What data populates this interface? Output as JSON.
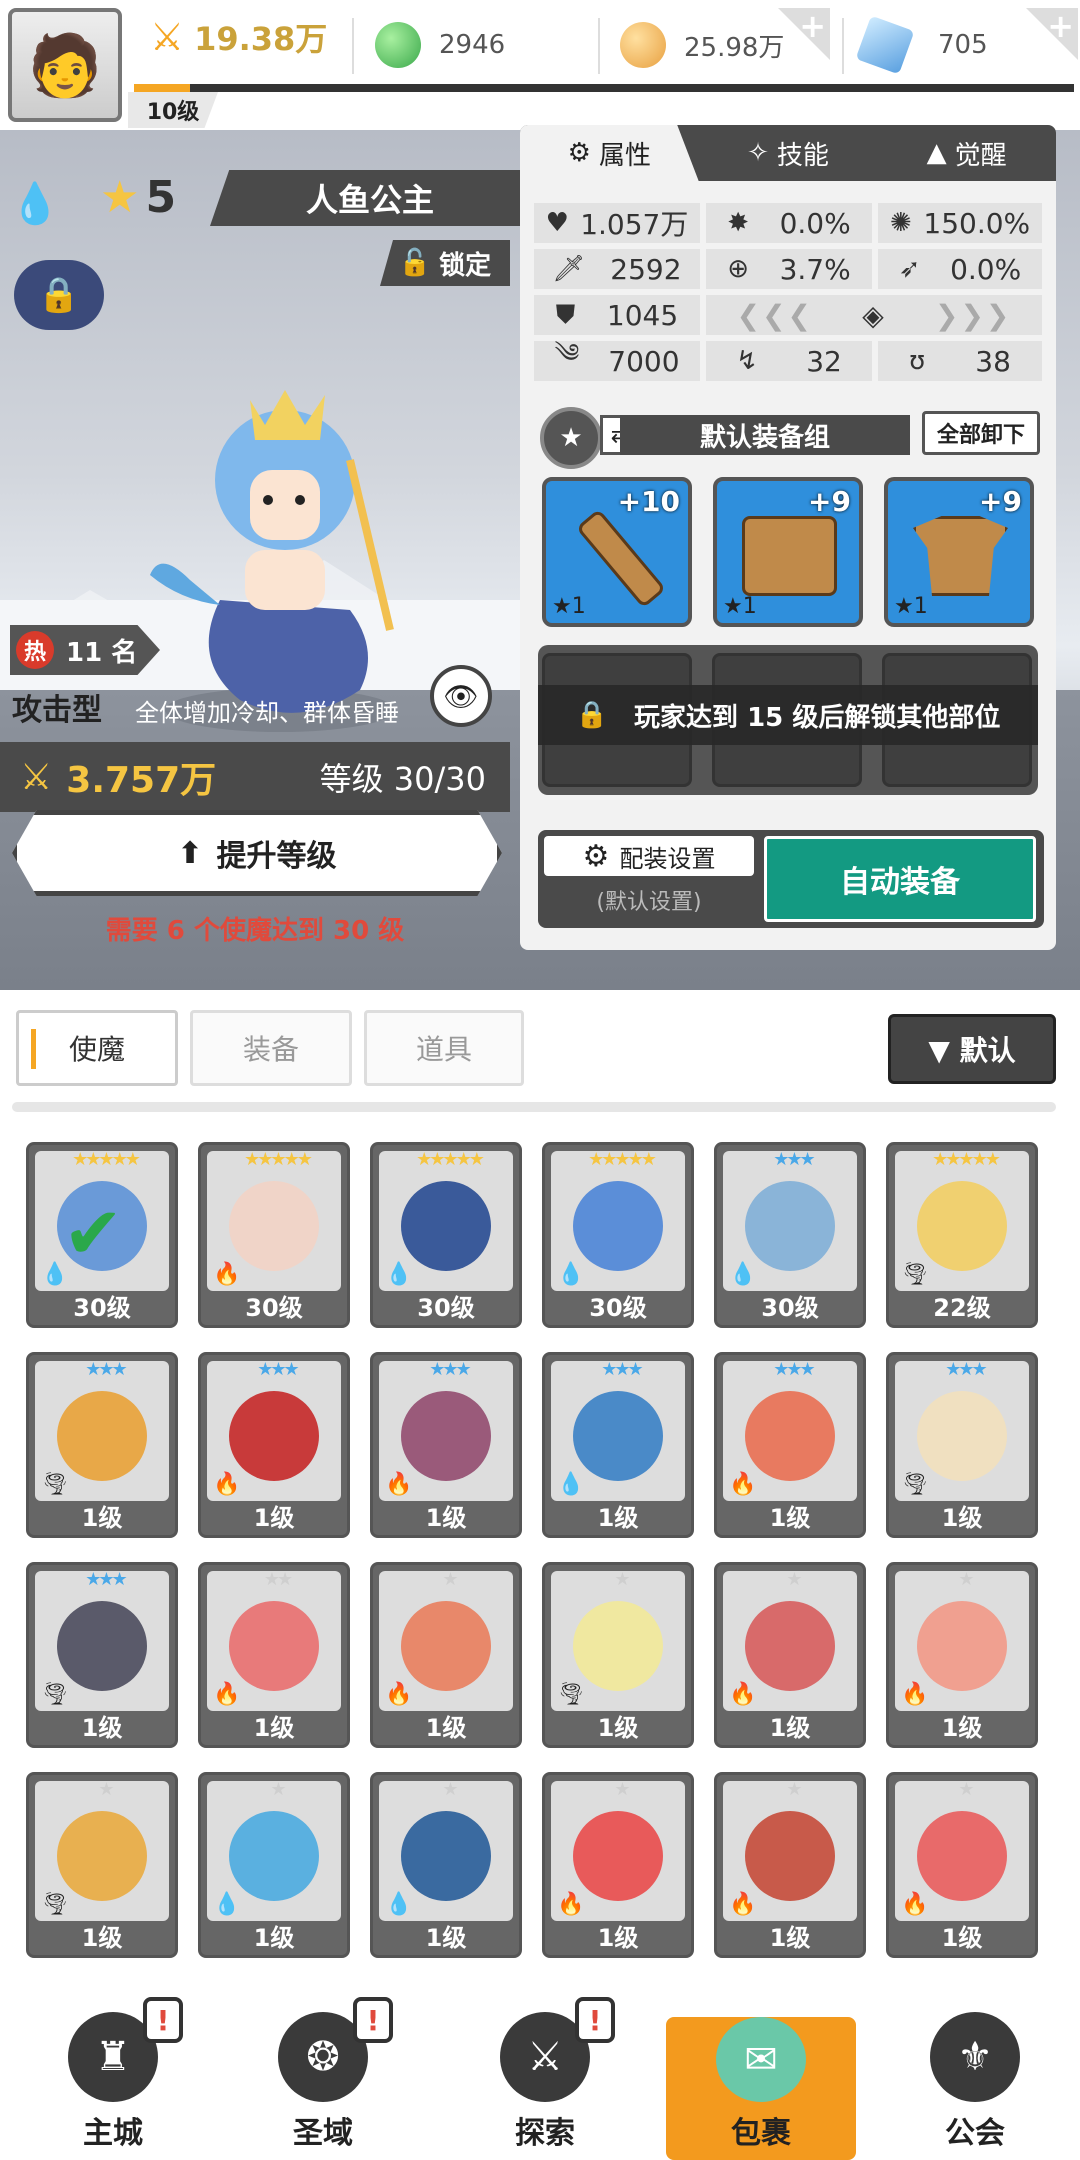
{
  "header": {
    "power_value": "19.38万",
    "player_level": "10级",
    "exp_fraction": 0.06,
    "resources": [
      {
        "name": "green-gem",
        "value": "2946",
        "color": "#5cc85a"
      },
      {
        "name": "gold-coin",
        "value": "25.98万",
        "color": "#f0b050"
      },
      {
        "name": "blue-crystal",
        "value": "705",
        "color": "#7ab8e8"
      }
    ],
    "plus_symbol": "+"
  },
  "hero": {
    "star_count": "5",
    "name": "人鱼公主",
    "lock_label": "锁定",
    "rank_hot": "热",
    "rank_text": "11 名",
    "type": "攻击型",
    "skill_desc": "全体增加冷却、群体昏睡",
    "power": "3.757万",
    "level_text": "等级 30/30",
    "upgrade_label": "提升等级",
    "requirement": "需要 6 个使魔达到 30 级"
  },
  "panel": {
    "tabs": [
      {
        "label": "属性",
        "icon": "attribute-icon"
      },
      {
        "label": "技能",
        "icon": "skill-icon"
      },
      {
        "label": "觉醒",
        "icon": "awaken-icon"
      }
    ],
    "stats": {
      "hp": "1.057万",
      "crit": "0.0%",
      "crit_dmg": "150.0%",
      "attack": "2592",
      "accuracy": "3.7%",
      "dodge": "0.0%",
      "defense": "1045",
      "speed": "7000",
      "stat_a": "32",
      "stat_b": "38"
    },
    "equip_group": "默认装备组",
    "unequip_all": "全部卸下",
    "slots": [
      {
        "plus": "+10",
        "stars": "★1",
        "item": "sword"
      },
      {
        "plus": "+9",
        "stars": "★1",
        "item": "chest"
      },
      {
        "plus": "+9",
        "stars": "★1",
        "item": "armor"
      }
    ],
    "lock_message": "玩家达到 15 级后解锁其他部位",
    "config_label": "配装设置",
    "config_sub": "(默认设置)",
    "auto_equip": "自动装备"
  },
  "list": {
    "tabs": [
      "使魔",
      "装备",
      "道具"
    ],
    "sort_label": "▼ 默认",
    "cards": [
      {
        "stars": "★★★★★",
        "star_color": "#f5c542",
        "elem": "💧",
        "lv": "30级",
        "color": "#6a9ad8",
        "selected": true
      },
      {
        "stars": "★★★★★",
        "star_color": "#f5c542",
        "elem": "🔥",
        "lv": "30级",
        "color": "#f0d4c8",
        "selected": false
      },
      {
        "stars": "★★★★★",
        "star_color": "#f5c542",
        "elem": "💧",
        "lv": "30级",
        "color": "#3a5a9a",
        "selected": false
      },
      {
        "stars": "★★★★★",
        "star_color": "#f5c542",
        "elem": "💧",
        "lv": "30级",
        "color": "#5b8ed8",
        "selected": false
      },
      {
        "stars": "★★★",
        "star_color": "#4aa8e8",
        "elem": "💧",
        "lv": "30级",
        "color": "#8ab4d8",
        "selected": false
      },
      {
        "stars": "★★★★★",
        "star_color": "#f5c542",
        "elem": "🌪",
        "lv": "22级",
        "color": "#f0d070",
        "selected": false
      },
      {
        "stars": "★★★",
        "star_color": "#4aa8e8",
        "elem": "🌪",
        "lv": "1级",
        "color": "#e8a848",
        "selected": false
      },
      {
        "stars": "★★★",
        "star_color": "#4aa8e8",
        "elem": "🔥",
        "lv": "1级",
        "color": "#c83a3a",
        "selected": false
      },
      {
        "stars": "★★★",
        "star_color": "#4aa8e8",
        "elem": "🔥",
        "lv": "1级",
        "color": "#9a5a7a",
        "selected": false
      },
      {
        "stars": "★★★",
        "star_color": "#4aa8e8",
        "elem": "💧",
        "lv": "1级",
        "color": "#4a8ac8",
        "selected": false
      },
      {
        "stars": "★★★",
        "star_color": "#4aa8e8",
        "elem": "🔥",
        "lv": "1级",
        "color": "#e87a60",
        "selected": false
      },
      {
        "stars": "★★★",
        "star_color": "#4aa8e8",
        "elem": "🌪",
        "lv": "1级",
        "color": "#f0e0c0",
        "selected": false
      },
      {
        "stars": "★★★",
        "star_color": "#4aa8e8",
        "elem": "🌪",
        "lv": "1级",
        "color": "#5a5a6a",
        "selected": false
      },
      {
        "stars": "★★",
        "star_color": "#cfcfcf",
        "elem": "🔥",
        "lv": "1级",
        "color": "#e87a7a",
        "selected": false
      },
      {
        "stars": "★",
        "star_color": "#cfcfcf",
        "elem": "🔥",
        "lv": "1级",
        "color": "#e8886a",
        "selected": false
      },
      {
        "stars": "★",
        "star_color": "#cfcfcf",
        "elem": "🌪",
        "lv": "1级",
        "color": "#f0e8a0",
        "selected": false
      },
      {
        "stars": "★",
        "star_color": "#cfcfcf",
        "elem": "🔥",
        "lv": "1级",
        "color": "#d86a6a",
        "selected": false
      },
      {
        "stars": "★",
        "star_color": "#cfcfcf",
        "elem": "🔥",
        "lv": "1级",
        "color": "#f0a090",
        "selected": false
      },
      {
        "stars": "★",
        "star_color": "#cfcfcf",
        "elem": "🌪",
        "lv": "1级",
        "color": "#e8b050",
        "selected": false
      },
      {
        "stars": "★",
        "star_color": "#cfcfcf",
        "elem": "💧",
        "lv": "1级",
        "color": "#5ab0e0",
        "selected": false
      },
      {
        "stars": "★",
        "star_color": "#cfcfcf",
        "elem": "💧",
        "lv": "1级",
        "color": "#3a6aa0",
        "selected": false
      },
      {
        "stars": "★",
        "star_color": "#cfcfcf",
        "elem": "🔥",
        "lv": "1级",
        "color": "#e85a5a",
        "selected": false
      },
      {
        "stars": "★",
        "star_color": "#cfcfcf",
        "elem": "🔥",
        "lv": "1级",
        "color": "#c85a4a",
        "selected": false
      },
      {
        "stars": "★",
        "star_color": "#cfcfcf",
        "elem": "🔥",
        "lv": "1级",
        "color": "#e86a6a",
        "selected": false
      }
    ]
  },
  "nav": {
    "items": [
      {
        "label": "主城",
        "icon": "castle-icon",
        "badge": "!"
      },
      {
        "label": "圣域",
        "icon": "portal-icon",
        "badge": "!"
      },
      {
        "label": "探索",
        "icon": "sword-stone-icon",
        "badge": "!"
      },
      {
        "label": "包裹",
        "icon": "bag-icon",
        "badge": ""
      },
      {
        "label": "公会",
        "icon": "guild-icon",
        "badge": ""
      }
    ]
  }
}
